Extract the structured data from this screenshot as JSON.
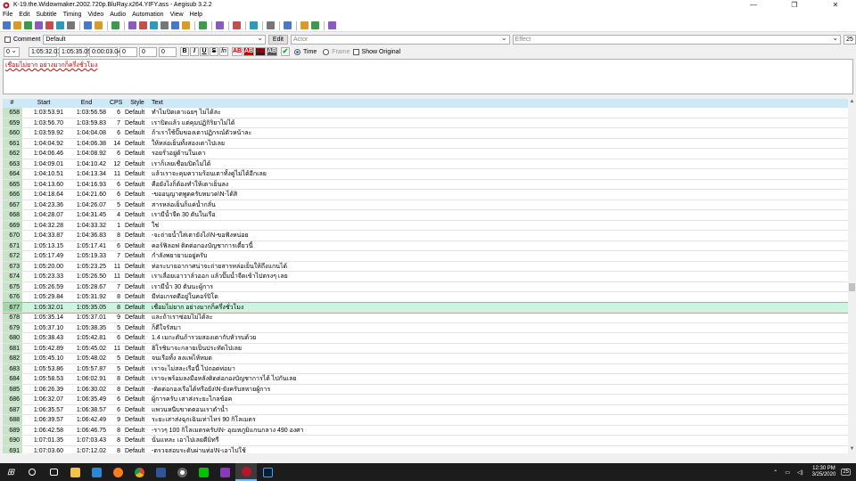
{
  "window": {
    "title": "K-19.the.Widowmaker.2002.720p.BluRay.x264.YIFY.ass - Aegisub 3.2.2",
    "minimize": "—",
    "maximize": "❐",
    "close": "✕"
  },
  "menu": [
    "File",
    "Edit",
    "Subtitle",
    "Timing",
    "Video",
    "Audio",
    "Automation",
    "View",
    "Help"
  ],
  "toolbar_icons": [
    "new-file-icon",
    "open-file-icon",
    "save-file-icon",
    "save-as-icon",
    "properties-icon",
    "attachments-icon",
    "fonts-collector-icon",
    "sep",
    "find-icon",
    "find-replace-icon",
    "sep",
    "jump-to-icon",
    "sep",
    "styles-manager-icon",
    "styling-assistant-icon",
    "translation-assistant-icon",
    "resample-icon",
    "timing-postprocessor-icon",
    "kanji-timer-icon",
    "sep",
    "paste-over-icon",
    "sep",
    "spell-check-icon",
    "sep",
    "fonts-icon",
    "sep",
    "video-icon",
    "sep",
    "details-icon",
    "sep",
    "keyframes-icon",
    "sep",
    "automation-icon",
    "help-icon",
    "sep",
    "options-icon"
  ],
  "editor": {
    "comment_label": "Comment",
    "style_value": "Default",
    "edit_label": "Edit",
    "actor_placeholder": "Actor",
    "effect_placeholder": "Effect",
    "char_count": "25",
    "layer": "0",
    "start_time": "1:05:32.01",
    "end_time": "1:05:35.05",
    "duration": "0:00:03.04",
    "margin_l": "0",
    "margin_r": "0",
    "margin_v": "0",
    "format_buttons": [
      "B",
      "I",
      "U",
      "S",
      "fn",
      "AB",
      "AB",
      "AB",
      "AB"
    ],
    "time_label": "Time",
    "frame_label": "Frame",
    "show_original_label": "Show Original",
    "text": "เชื่อมไม่ยาก อย่างมากก็ครึ่งชั่วโมง"
  },
  "grid": {
    "headers": [
      "#",
      "Start",
      "End",
      "CPS",
      "Style",
      "Text"
    ],
    "rows": [
      [
        "658",
        "1:03:53.91",
        "1:03:56.58",
        "6",
        "Default",
        "ทำไมปิดเตาเฉยๆ ไม่ได้ละ"
      ],
      [
        "659",
        "1:03:56.70",
        "1:03:59.83",
        "7",
        "Default",
        "เราปิดแล้ว แต่คุมปฏิกิริยาไม่ได้"
      ],
      [
        "660",
        "1:03:59.92",
        "1:04:04.08",
        "6",
        "Default",
        "ถ้าเราใช้ปั๊มของเตาปฏิกรณ์ตัวหน้าละ"
      ],
      [
        "661",
        "1:04:04.92",
        "1:04:06.38",
        "14",
        "Default",
        "ให้หล่อเย็นทั้งสองเตาไปเลย"
      ],
      [
        "662",
        "1:04:06.46",
        "1:04:08.92",
        "6",
        "Default",
        "รอยรั่วอยู่ด้านในเตา"
      ],
      [
        "663",
        "1:04:09.01",
        "1:04:10.42",
        "12",
        "Default",
        "เราก็เลยเชื่อมปิดไม่ได้"
      ],
      [
        "664",
        "1:04:10.51",
        "1:04:13.34",
        "11",
        "Default",
        "แล้วเราจะคุมความร้อนเตาทั้งคู่ไม่ได้อีกเลย"
      ],
      [
        "665",
        "1:04:13.60",
        "1:04:16.93",
        "6",
        "Default",
        "คือยังไงก็ต้องทำให้เตาเย็นลง"
      ],
      [
        "666",
        "1:04:18.64",
        "1:04:21.60",
        "6",
        "Default",
        "-ขออนุญาตพูดครับหมวด\\N-ได้สิ"
      ],
      [
        "667",
        "1:04:23.36",
        "1:04:26.07",
        "5",
        "Default",
        "สารหล่อเย็นก็แค่น้ำกลั่น"
      ],
      [
        "668",
        "1:04:28.07",
        "1:04:31.45",
        "4",
        "Default",
        "เรามีน้ำจืด 30 ตันในเรือ"
      ],
      [
        "669",
        "1:04:32.28",
        "1:04:33.32",
        "1",
        "Default",
        "ใช่"
      ],
      [
        "670",
        "1:04:33.87",
        "1:04:36.83",
        "8",
        "Default",
        "-จะถ่ายน้ำใส่เตายังไง\\N-ขอฟังหน่อย"
      ],
      [
        "671",
        "1:05:13.15",
        "1:05:17.41",
        "6",
        "Default",
        "คอร์ฟิลอฟ ติดต่อกองบัญชาการเดี๋ยวนี้"
      ],
      [
        "672",
        "1:05:17.49",
        "1:05:19.33",
        "7",
        "Default",
        "กำลังพยายามอยู่ครับ"
      ],
      [
        "673",
        "1:05:20.00",
        "1:05:23.25",
        "11",
        "Default",
        "ท่อระบายอากาศน่าจะถ่ายสารหล่อเย็นให้ถึงแกนได้"
      ],
      [
        "674",
        "1:05:23.33",
        "1:05:26.50",
        "11",
        "Default",
        "เราเลื่อยเอาวาล์วออก แล้วปั๊มน้ำจืดเข้าไปตรงๆ เลย"
      ],
      [
        "675",
        "1:05:26.59",
        "1:05:28.67",
        "7",
        "Default",
        "เรามีน้ำ 30 ตันนะผู้การ"
      ],
      [
        "676",
        "1:05:29.84",
        "1:05:31.92",
        "8",
        "Default",
        "มีท่อเกรดดีอยู่ในคอร์ปิโด"
      ],
      [
        "677",
        "1:05:32.01",
        "1:05:35.05",
        "8",
        "Default",
        "เชื่อมไม่ยาก อย่างมากก็ครึ่งชั่วโมง"
      ],
      [
        "678",
        "1:05:35.14",
        "1:05:37.01",
        "9",
        "Default",
        "และถ้าเราซ่อมไม่ได้ละ"
      ],
      [
        "679",
        "1:05:37.10",
        "1:05:38.35",
        "5",
        "Default",
        "ก็ดีใจรัสมา"
      ],
      [
        "680",
        "1:05:38.43",
        "1:05:42.81",
        "6",
        "Default",
        "1.4 เมกะตันถ้ารวมสองเตากับหัวรบด้วย"
      ],
      [
        "681",
        "1:05:42.89",
        "1:05:45.02",
        "11",
        "Default",
        "ฮิโรชิมาจะกลายเป็นประทัดไปเลย"
      ],
      [
        "682",
        "1:05:45.10",
        "1:05:48.02",
        "5",
        "Default",
        "จนเรือทั้ง ลงแพไห้หมด"
      ],
      [
        "683",
        "1:05:53.86",
        "1:05:57.87",
        "5",
        "Default",
        "เราจะไม่สละเรือนี้ ไปถอดท่อมา"
      ],
      [
        "684",
        "1:05:58.53",
        "1:06:02.91",
        "8",
        "Default",
        "เราจะพร้อมลงมือหลังติดต่อกองบัญชาการได้ ไปกันเลย"
      ],
      [
        "685",
        "1:06:26.39",
        "1:06:30.02",
        "8",
        "Default",
        "-ติดต่อกองเรือได้หรือยัง\\N-ยังครับสหายผู้การ"
      ],
      [
        "686",
        "1:06:32.07",
        "1:06:35.49",
        "6",
        "Default",
        "ผู้การครับ เสาส่งระยะไกลข้อค"
      ],
      [
        "687",
        "1:06:35.57",
        "1:06:38.57",
        "6",
        "Default",
        "แพวนหนีบขาดตอนเราดำน้ำ"
      ],
      [
        "688",
        "1:06:39.57",
        "1:06:42.49",
        "9",
        "Default",
        "ระยะเสาส่งฉุกเฉินเท่าไหร่ 90 กิโลเมตร"
      ],
      [
        "689",
        "1:06:42.58",
        "1:06:46.75",
        "8",
        "Default",
        "-ราวๆ 100 กิโลเมตรครับ\\N- อุณหภูมิแกนกลาง 490 องศา"
      ],
      [
        "690",
        "1:07:01.35",
        "1:07:03.43",
        "8",
        "Default",
        "นั่นแหละ เอาไปเลยดีมิทรี"
      ],
      [
        "691",
        "1:07:03.60",
        "1:07:12.02",
        "8",
        "Default",
        "-ตรวจสอบระดับผ่านท่อ\\N-เอาไปใช้"
      ]
    ],
    "selected_row": "677"
  },
  "taskbar": {
    "icons": [
      "start-icon",
      "search-icon",
      "task-view-icon",
      "file-explorer-icon",
      "mail-icon",
      "firefox-icon",
      "chrome-icon",
      "word-icon",
      "chrome-icon-2",
      "line-icon",
      "vpn-icon",
      "aegisub-icon",
      "photoshop-icon"
    ],
    "time": "12:30 PM",
    "date": "3/25/2020",
    "notifications": "25"
  },
  "colors": {
    "header_bg": "#cde8f7",
    "rownum_bg": "#c7e4c8",
    "selected_bg": "#cdf5dd",
    "taskbar": "#1c1c1c"
  }
}
